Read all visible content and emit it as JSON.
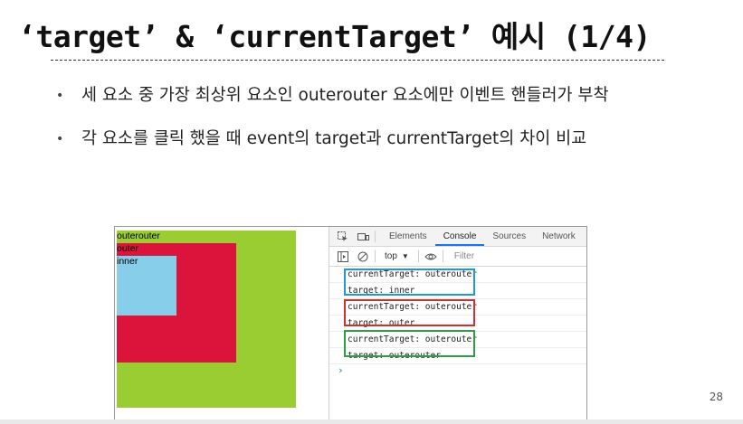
{
  "slide": {
    "title": "‘target’ & ‘currentTarget’ 예시 (1/4)",
    "bullets": [
      "세 요소 중 가장 최상위 요소인 outerouter 요소에만 이벤트 핸들러가 부착",
      "각 요소를 클릭 했을 때 event의 target과 currentTarget의 차이 비교"
    ],
    "page_number": "28"
  },
  "demo": {
    "outerouter_label": "outerouter",
    "outer_label": "outer",
    "inner_label": "inner",
    "colors": {
      "outerouter": "#9acd32",
      "outer": "#dc143c",
      "inner": "#87ceeb"
    }
  },
  "devtools": {
    "tabs": [
      "Elements",
      "Console",
      "Sources",
      "Network"
    ],
    "active_tab": "Console",
    "context": "top",
    "filter_placeholder": "Filter",
    "logs": [
      "currentTarget: outerouter",
      "target: inner",
      "currentTarget: outerouter",
      "target: outer",
      "currentTarget: outerouter",
      "target: outerouter"
    ],
    "prompt": "›",
    "group_colors": [
      "#1f9bd1",
      "#d32f2f",
      "#2e9e44"
    ],
    "icons": [
      "inspect-icon",
      "device-toggle-icon",
      "sidebar-toggle-icon",
      "clear-console-icon",
      "dropdown-arrow-icon",
      "eye-icon"
    ]
  }
}
